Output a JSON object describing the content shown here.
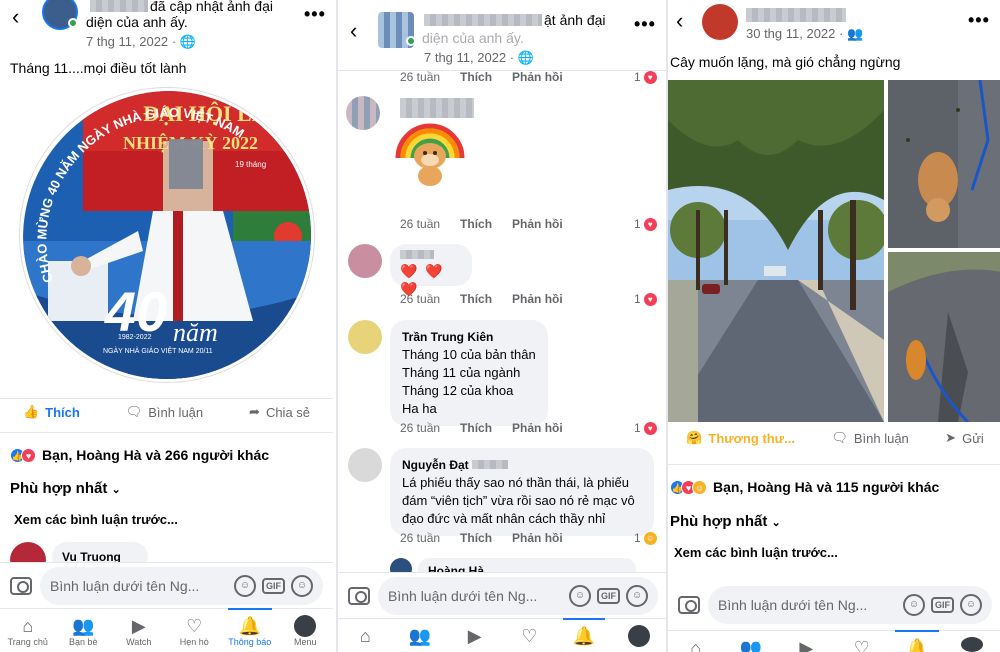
{
  "colors": {
    "accent": "#1877f2",
    "heart": "#f33e58",
    "care": "#f7b125"
  },
  "panel1": {
    "header_text": "đã cập nhật ảnh đại diện của anh ấy.",
    "header_text_line1": "đã cập nhật ảnh đại",
    "header_text_line2": "diện của anh ấy.",
    "date": "7 thg 11, 2022 ·",
    "caption": "Tháng 11....mọi điều tốt lành",
    "image_texts": {
      "banner": "ĐẠI HỘI LẦN",
      "term": "NHIỆM KỲ 2022",
      "date_small": "19 tháng",
      "arc": "CHÀO MỪNG 40 NĂM NGÀY NHÀ GIÁO VIỆT NAM",
      "big_number": "40",
      "nam": "năm",
      "years": "1982-2022",
      "footer": "NGÀY NHÀ GIÁO VIỆT NAM 20/11"
    },
    "actions": {
      "like": "Thích",
      "comment": "Bình luận",
      "share": "Chia sẻ"
    },
    "reactions_summary": "Bạn, Hoàng Hà và 266 người khác",
    "sort": "Phù hợp nhất",
    "previous_comments": "Xem các bình luận trước...",
    "partial_comment_author": "Vu Truong",
    "composer_placeholder": "Bình luận dưới tên Ng...",
    "tabs": [
      {
        "label": "Trang chủ",
        "icon": "home-icon"
      },
      {
        "label": "Bạn bè",
        "icon": "friends-icon"
      },
      {
        "label": "Watch",
        "icon": "watch-icon"
      },
      {
        "label": "Hẹn hò",
        "icon": "dating-icon"
      },
      {
        "label": "Thông báo",
        "icon": "bell-icon"
      },
      {
        "label": "Menu",
        "icon": "menu-icon"
      }
    ]
  },
  "panel2": {
    "header_text": "ật ảnh đại",
    "header_text_line2": "diện của anh ấy.",
    "date": "7 thg 11, 2022 ·",
    "first_meta": {
      "time": "26 tuần",
      "like": "Thích",
      "reply": "Phản hồi",
      "count": "1"
    },
    "comments": [
      {
        "author": "",
        "text": "",
        "time": "26 tuần",
        "count": "1"
      },
      {
        "author": "",
        "text": "❤️ ❤️ ❤️",
        "time": "26 tuần",
        "count": "1"
      },
      {
        "author": "Trần Trung Kiên",
        "lines": [
          "Tháng 10 của bản thân",
          "Tháng 11 của ngành",
          "Tháng 12 của khoa",
          "Ha ha"
        ],
        "time": "26 tuần",
        "count": "1"
      },
      {
        "author": "Nguyễn Đạt",
        "lines": [
          "Lá phiếu thấy sao nó thần thái, là phiếu",
          "đám “viên tịch” vừa rồi sao nó rẻ mạc vô",
          "đạo đức và mất nhân cách thầy nhỉ"
        ],
        "time": "26 tuần",
        "count": "1"
      }
    ],
    "partial_reply_author": "Hoàng Hà",
    "like_label": "Thích",
    "reply_label": "Phản hồi",
    "composer_placeholder": "Bình luận dưới tên Ng..."
  },
  "panel3": {
    "date": "30 thg 11, 2022 ·",
    "caption": "Cây muốn lặng, mà gió chẳng ngừng",
    "actions": {
      "react": "Thương thư...",
      "comment": "Bình luận",
      "send": "Gửi"
    },
    "reactions_summary": "Bạn, Hoàng Hà và 115 người khác",
    "sort": "Phù hợp nhất",
    "previous_comments": "Xem các bình luận trước...",
    "composer_placeholder": "Bình luận dưới tên Ng..."
  }
}
